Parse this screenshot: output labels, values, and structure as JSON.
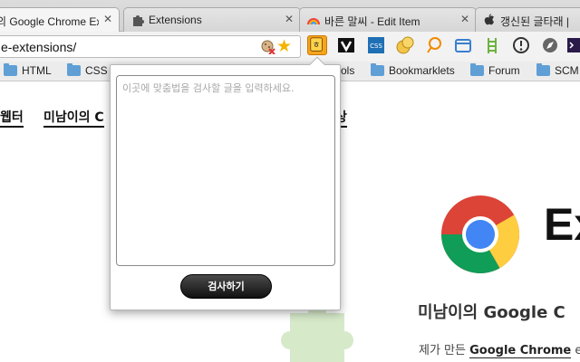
{
  "tabs": [
    {
      "title": "의 Google Chrome Ext",
      "icon": "none",
      "active": true
    },
    {
      "title": "Extensions",
      "icon": "puzzle-icon",
      "active": false
    },
    {
      "title": "바른 말씨 - Edit Item",
      "icon": "rainbow-icon",
      "active": false
    },
    {
      "title": "갱신된 글타래 | Alb",
      "icon": "apple-icon",
      "active": false
    }
  ],
  "tab_close_glyph": "✕",
  "omnibox": {
    "url": "e-extensions/"
  },
  "extensions": [
    "hangul-check-icon",
    "v-icon",
    "css-icon",
    "coin-icon",
    "speech-bubble-icon",
    "folder-icon",
    "ladder-icon",
    "info-icon",
    "compass-icon",
    "terminal-icon"
  ],
  "bookmarks": [
    "HTML",
    "CSS",
    "ols",
    "Bookmarklets",
    "Forum",
    "SCM"
  ],
  "page": {
    "nav": [
      "웹터",
      "미남이의 C",
      "상"
    ],
    "big_title": "Ex",
    "heading": "미남이의 Google C",
    "para_prefix": "제가 만든 ",
    "para_link": "Google Chrome",
    "para_suffix": " e"
  },
  "popup": {
    "placeholder": "이곳에 맞춤법을 검사할 글을 입력하세요.",
    "button": "검사하기"
  },
  "colors": {
    "accent": "#f7a51a"
  }
}
